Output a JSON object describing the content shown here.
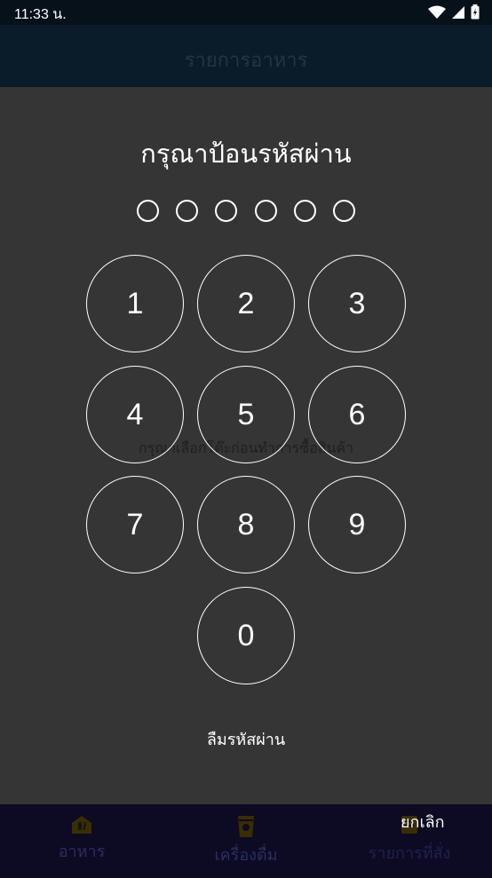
{
  "status_bar": {
    "time": "11:33 น."
  },
  "app_bar": {
    "title": "รายการอาหาร"
  },
  "background": {
    "hint": "กรุณาเลือกโต๊ะก่อนทำการซื้อสินค้า"
  },
  "passcode": {
    "title": "กรุณาป้อนรหัสผ่าน",
    "digits_entered": 0,
    "digits_total": 6,
    "keys": [
      "1",
      "2",
      "3",
      "4",
      "5",
      "6",
      "7",
      "8",
      "9",
      "0"
    ],
    "forgot_label": "ลืมรหัสผ่าน",
    "cancel_label": "ยกเลิก"
  },
  "bottom_nav": {
    "items": [
      {
        "label": "อาหาร",
        "icon": "food-icon"
      },
      {
        "label": "เครื่องดื่ม",
        "icon": "drink-icon"
      },
      {
        "label": "รายการที่สั่ง",
        "icon": "order-list-icon"
      }
    ]
  },
  "colors": {
    "dialog_bg": "#353535",
    "status_bg": "#07111a",
    "nav_bg": "#0d0a24",
    "nav_icon": "#3a2e00"
  }
}
